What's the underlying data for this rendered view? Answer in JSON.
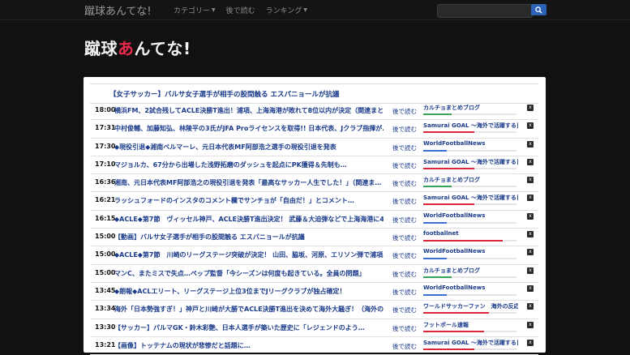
{
  "site": {
    "brand": "蹴球あんてな!",
    "logo_main": "蹴球",
    "logo_accent": "あ",
    "logo_rest": "んてな!"
  },
  "nav": {
    "items": [
      {
        "label": "カテゴリー",
        "has_caret": true
      },
      {
        "label": "後で読む",
        "has_caret": false
      },
      {
        "label": "ランキング",
        "has_caret": true
      }
    ],
    "search_placeholder": ""
  },
  "colors": {
    "accent": "#e8294c",
    "link": "#1a3a8a",
    "bar_red": "#d9283a",
    "bar_blue": "#3b6fd1",
    "bar_green": "#3aa35a"
  },
  "headline": "【女子サッカー】バルサ女子選手が相手の股間触る エスパニョールが抗議",
  "later_label": "後で読む",
  "close_label": "x",
  "articles": [
    {
      "time": "18:00",
      "title": "横浜FM、2試合残してACLE決勝T進出！浦項、上海海港が敗れて8位以内が決定（関連まと…",
      "source": "カルチョまとめブログ",
      "bar": 0.3,
      "color": "green"
    },
    {
      "time": "17:31",
      "title": "中村俊輔、加藤知弘、林陵平の3氏がJFA Proライセンスを取得!! 日本代表、Jクラブ指揮が…",
      "source": "Samurai GOAL ～海外で活躍する日本人",
      "bar": 0.55,
      "color": "red"
    },
    {
      "time": "17:30",
      "title": "◆現役引退◆湘南ベルマーレ、元日本代表MF阿部浩之選手の現役引退を発表",
      "source": "WorldFootballNews",
      "bar": 0.25,
      "color": "blue"
    },
    {
      "time": "17:10",
      "title": "マジョルカ、67分から出場した浅野拓磨のダッシュを起点にPK獲得＆先制も…",
      "source": "Samurai GOAL ～海外で活躍する日本人",
      "bar": 0.55,
      "color": "red"
    },
    {
      "time": "16:36",
      "title": "湘南、元日本代表MF阿部浩之の現役引退を発表「最高なサッカー人生でした！」（関連ま…",
      "source": "カルチョまとめブログ",
      "bar": 0.3,
      "color": "green"
    },
    {
      "time": "16:21",
      "title": "ラッシュフォードのインスタのコメント欄でサンチョが「自由だ！」とコメント…",
      "source": "Samurai GOAL ～海外で活躍する日本人",
      "bar": 0.55,
      "color": "red"
    },
    {
      "time": "16:15",
      "title": "◆ACLE◆第7節　ヴィッセル神戸、ACLE決勝T進出決定！ 武藤＆大迫弾などで上海海港に4…",
      "source": "WorldFootballNews",
      "bar": 0.25,
      "color": "blue"
    },
    {
      "time": "15:00",
      "title": "【動画】バルサ女子選手が相手の股間触る エスパニョールが抗議",
      "source": "footballnet",
      "bar": 0.85,
      "color": "red"
    },
    {
      "time": "15:00",
      "title": "◆ACLE◆第7節　川崎のリーグステージ突破が決定！ 山田、脇坂、河原、エリソン弾で浦項…",
      "source": "WorldFootballNews",
      "bar": 0.25,
      "color": "blue"
    },
    {
      "time": "15:00",
      "title": "マンC、またミスで失点…ペップ監督「今シーズンは何度も起きている。全員の問題」",
      "source": "カルチョまとめブログ",
      "bar": 0.3,
      "color": "green"
    },
    {
      "time": "13:45",
      "title": "◆朗報◆ACLエリート、リーグステージ上位3位までJリーグクラブが独占確定！",
      "source": "WorldFootballNews",
      "bar": 0.25,
      "color": "blue"
    },
    {
      "time": "13:34",
      "title": "海外「日本勢強すぎ！」神戸と川崎が大勝でACLE決勝T進出を決めて海外大騒ぎ！（海外の…",
      "source": "ワールドサッカーファン　海外の反応",
      "bar": 0.7,
      "color": "red"
    },
    {
      "time": "13:30",
      "title": "【サッカー】パルマGK・鈴木彩艶、日本人選手が築いた歴史に「レジェンドのよう…",
      "source": "フットボール速報",
      "bar": 0.65,
      "color": "red"
    },
    {
      "time": "13:21",
      "title": "【画像】トッテナムの現状が悲惨だと話題に…",
      "source": "Samurai GOAL ～海外で活躍する日本人",
      "bar": 0.55,
      "color": "red"
    }
  ]
}
